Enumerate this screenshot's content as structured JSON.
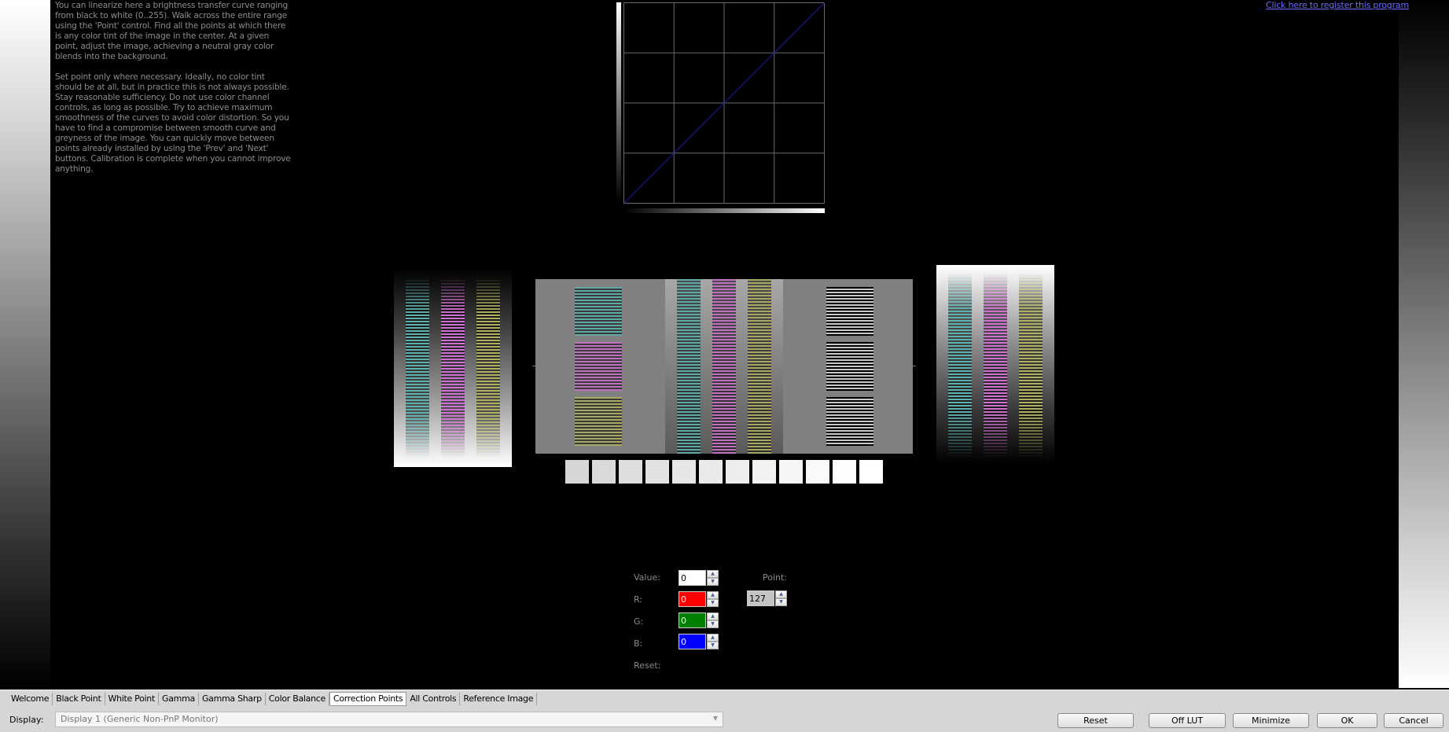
{
  "help": {
    "paragraph1": "You can linearize here a brightness transfer curve ranging from black to white (0..255). Walk across the entire range using the 'Point' control. Find all the points at which there is any color tint of the image in the center. At a given point, adjust the image, achieving a neutral gray color blends into the background.",
    "paragraph2": "Set point only where necessary. Ideally, no color tint should be at all, but in practice this is not always possible. Stay reasonable sufficiency. Do not use color channel controls, as long as possible. Try to achieve maximum smoothness of the curves to avoid color distortion. So you have to find a compromise between smooth curve and greyness of the image. You can quickly move between points already installed by using the 'Prev' and 'Next' buttons. Calibration is complete when you cannot improve anything."
  },
  "register_link": "Click here to register this program",
  "curve": {
    "grid_divisions": 4,
    "line_color": "#1a1aa8",
    "points": [
      [
        0,
        0
      ],
      [
        255,
        255
      ]
    ]
  },
  "swatch_levels": [
    214,
    218,
    222,
    226,
    230,
    234,
    238,
    242,
    246,
    250,
    253,
    255
  ],
  "controls": {
    "value_label": "Value:",
    "value": "0",
    "r_label": "R:",
    "r_value": "0",
    "r_color": "#ff0000",
    "g_label": "G:",
    "g_value": "0",
    "g_color": "#008000",
    "b_label": "B:",
    "b_value": "0",
    "b_color": "#0000ff",
    "reset_label": "Reset:",
    "point_label": "Point:",
    "point_value": "127"
  },
  "tabs": [
    {
      "label": "Welcome",
      "active": false
    },
    {
      "label": "Black Point",
      "active": false
    },
    {
      "label": "White Point",
      "active": false
    },
    {
      "label": "Gamma",
      "active": false
    },
    {
      "label": "Gamma Sharp",
      "active": false
    },
    {
      "label": "Color Balance",
      "active": false
    },
    {
      "label": "Correction Points",
      "active": true
    },
    {
      "label": "All Controls",
      "active": false
    },
    {
      "label": "Reference Image",
      "active": false
    }
  ],
  "display": {
    "label": "Display:",
    "selected": "Display 1 (Generic Non-PnP Monitor)"
  },
  "buttons": {
    "reset": "Reset",
    "off_lut": "Off LUT",
    "minimize": "Minimize",
    "ok": "OK",
    "cancel": "Cancel"
  }
}
